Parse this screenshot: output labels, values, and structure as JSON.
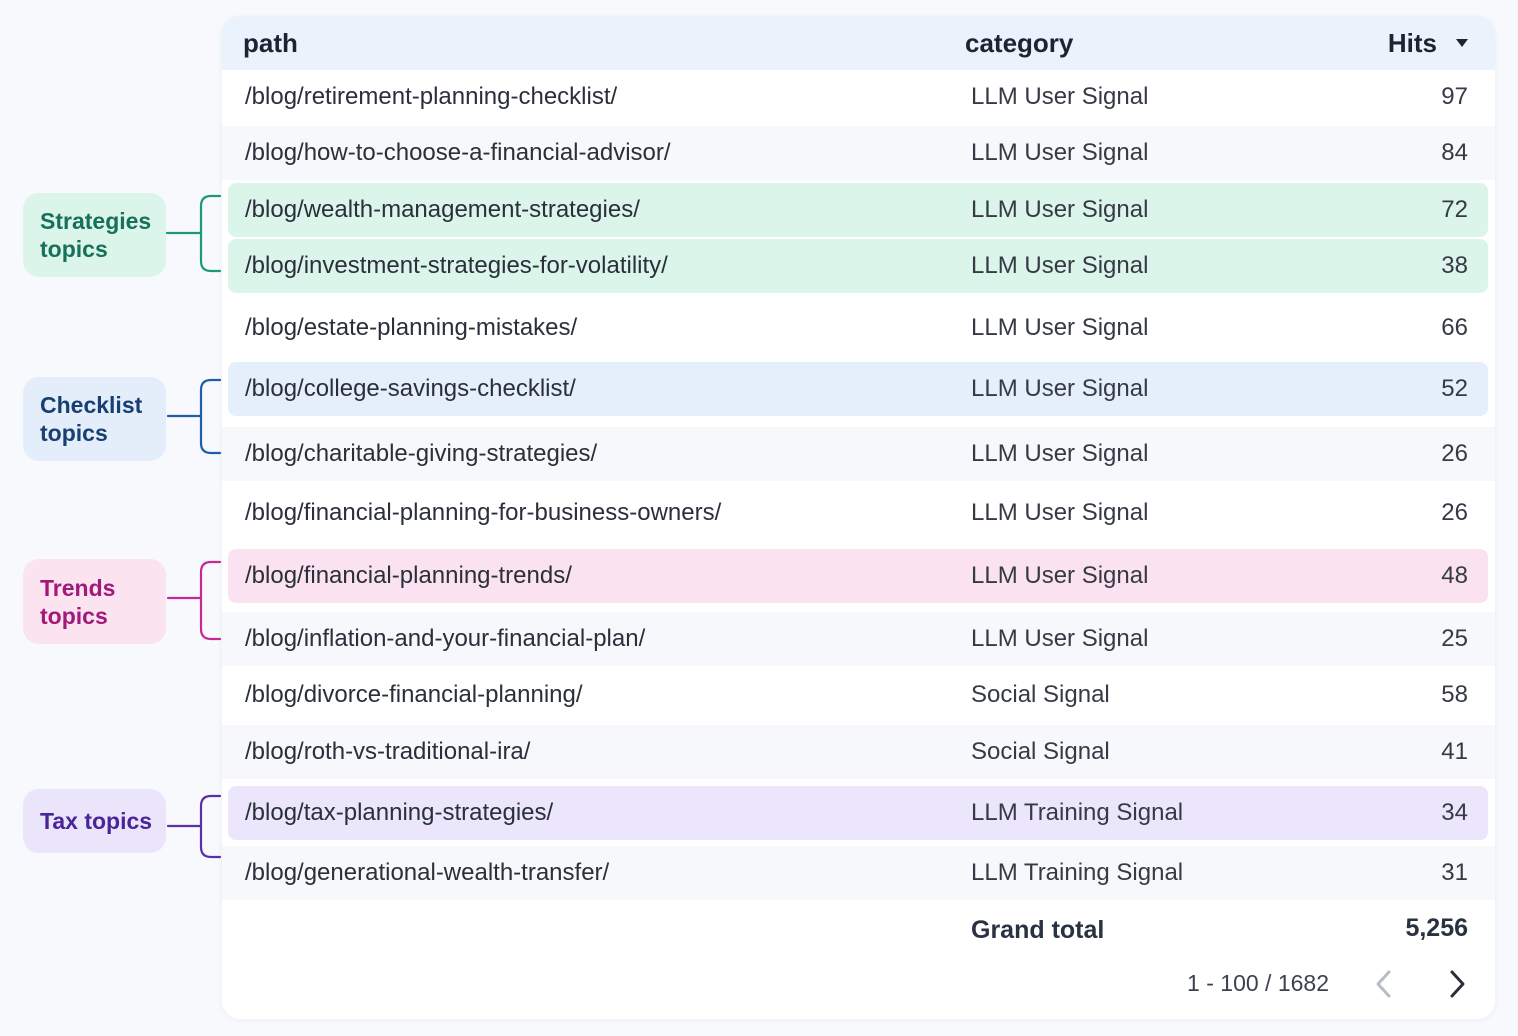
{
  "table": {
    "columns": {
      "path": "path",
      "category": "category",
      "hits": "Hits"
    },
    "rows": [
      {
        "path": "/blog/retirement-planning-checklist/",
        "category": "LLM User Signal",
        "hits": "97"
      },
      {
        "path": "/blog/how-to-choose-a-financial-advisor/",
        "category": "LLM User Signal",
        "hits": "84"
      },
      {
        "path": "/blog/wealth-management-strategies/",
        "category": "LLM User Signal",
        "hits": "72"
      },
      {
        "path": "/blog/investment-strategies-for-volatility/",
        "category": "LLM User Signal",
        "hits": "38"
      },
      {
        "path": "/blog/estate-planning-mistakes/",
        "category": "LLM User Signal",
        "hits": "66"
      },
      {
        "path": "/blog/college-savings-checklist/",
        "category": "LLM User Signal",
        "hits": "52"
      },
      {
        "path": "/blog/charitable-giving-strategies/",
        "category": "LLM User Signal",
        "hits": "26"
      },
      {
        "path": "/blog/financial-planning-for-business-owners/",
        "category": "LLM User Signal",
        "hits": "26"
      },
      {
        "path": "/blog/financial-planning-trends/",
        "category": "LLM User Signal",
        "hits": "48"
      },
      {
        "path": "/blog/inflation-and-your-financial-plan/",
        "category": "LLM User Signal",
        "hits": "25"
      },
      {
        "path": "/blog/divorce-financial-planning/",
        "category": "Social Signal",
        "hits": "58"
      },
      {
        "path": "/blog/roth-vs-traditional-ira/",
        "category": "Social Signal",
        "hits": "41"
      },
      {
        "path": "/blog/tax-planning-strategies/",
        "category": "LLM Training Signal",
        "hits": "34"
      },
      {
        "path": "/blog/generational-wealth-transfer/",
        "category": "LLM Training Signal",
        "hits": "31"
      }
    ],
    "grand_total_label": "Grand total",
    "grand_total_value": "5,256",
    "pagination": "1 - 100 / 1682",
    "sort_icon": "caret-down-icon"
  },
  "groups": [
    {
      "label": "Strategies\ntopics",
      "color": "#17705a",
      "bg": "#dcf5ea"
    },
    {
      "label": "Checklist\ntopics",
      "color": "#173f72",
      "bg": "#e3eefa"
    },
    {
      "label": "Trends\ntopics",
      "color": "#a2197a",
      "bg": "#fbe3f0"
    },
    {
      "label": "Tax topics",
      "color": "#4a2599",
      "bg": "#ebe5fb"
    }
  ]
}
